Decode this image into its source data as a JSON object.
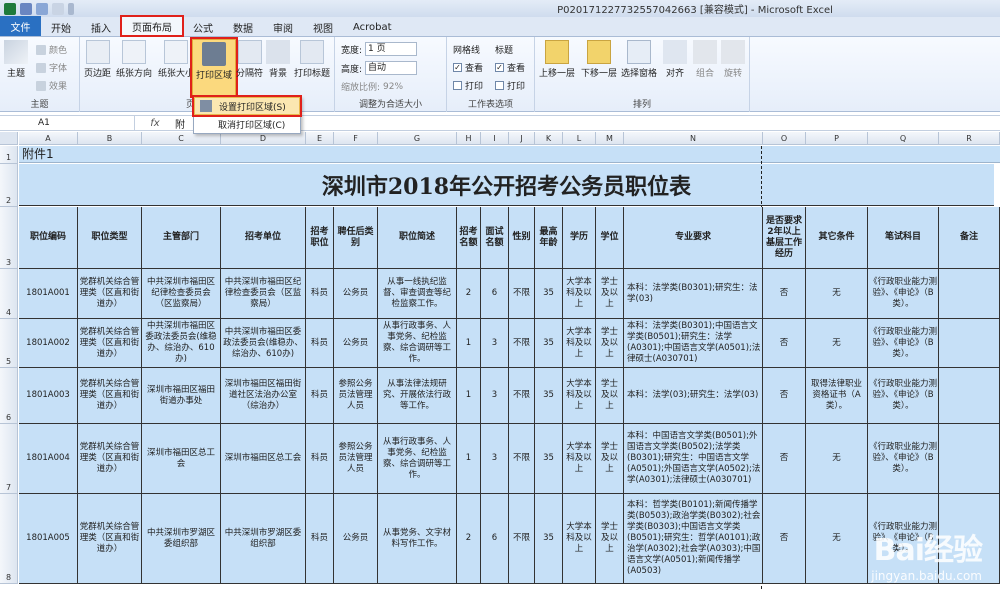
{
  "window": {
    "title": "P020171227732557042663 [兼容模式] - Microsoft Excel"
  },
  "tabs": {
    "file": "文件",
    "items": [
      "开始",
      "插入",
      "页面布局",
      "公式",
      "数据",
      "审阅",
      "视图",
      "Acrobat"
    ],
    "active": "页面布局"
  },
  "ribbon": {
    "theme": {
      "main": "主题",
      "colors": "颜色",
      "fonts": "字体",
      "effects": "效果",
      "group": "主题"
    },
    "page_setup": {
      "margins": "页边距",
      "orientation": "纸张方向",
      "size": "纸张大小",
      "print_area": "打印区域",
      "breaks": "分隔符",
      "background": "背景",
      "print_titles": "打印标题",
      "group": "页"
    },
    "scale": {
      "width_label": "宽度:",
      "width_value": "1 页",
      "height_label": "高度:",
      "height_value": "自动",
      "scale_label": "缩放比例:",
      "scale_value": "92%",
      "group": "调整为合适大小"
    },
    "sheet_options": {
      "gridlines": "网格线",
      "headings": "标题",
      "view": "查看",
      "print": "打印",
      "group": "工作表选项"
    },
    "arrange": {
      "bring_forward": "上移一层",
      "send_backward": "下移一层",
      "selection_pane": "选择窗格",
      "align": "对齐",
      "group_btn": "组合",
      "rotate": "旋转",
      "group": "排列"
    }
  },
  "print_area_menu": {
    "set": "设置打印区域(S)",
    "clear": "取消打印区域(C)"
  },
  "formula_bar": {
    "name_box": "A1",
    "fx": "fx",
    "value": "附"
  },
  "columns": [
    "A",
    "B",
    "C",
    "D",
    "E",
    "F",
    "G",
    "H",
    "I",
    "J",
    "K",
    "L",
    "M",
    "N",
    "O",
    "P",
    "Q",
    "R"
  ],
  "rows": [
    "1",
    "2",
    "3",
    "4",
    "5",
    "6",
    "7",
    "8"
  ],
  "sheet": {
    "a1": "附件1",
    "title": "深圳市2018年公开招考公务员职位表",
    "headers": [
      "职位编码",
      "职位类型",
      "主管部门",
      "招考单位",
      "招考职位",
      "聘任后类别",
      "职位简述",
      "招考名额",
      "面试名额",
      "性别",
      "最高年龄",
      "学历",
      "学位",
      "专业要求",
      "是否要求2年以上基层工作经历",
      "其它条件",
      "笔试科目",
      "备注"
    ],
    "records": [
      [
        "1801A001",
        "党群机关综合管理类（区直和街道办）",
        "中共深圳市福田区纪律检查委员会（区监察局）",
        "中共深圳市福田区纪律检查委员会（区监察局）",
        "科员",
        "公务员",
        "从事一线执纪监督、审查调查等纪检监察工作。",
        "2",
        "6",
        "不限",
        "35",
        "大学本科及以上",
        "学士及以上",
        "本科：法学类(B0301);研究生：法学(03)",
        "否",
        "无",
        "《行政职业能力测验》、《申论》（B类）。",
        ""
      ],
      [
        "1801A002",
        "党群机关综合管理类（区直和街道办）",
        "中共深圳市福田区委政法委员会(维稳办、综治办、610办)",
        "中共深圳市福田区委政法委员会(维稳办、综治办、610办)",
        "科员",
        "公务员",
        "从事行政事务、人事党务、纪检监察、综合调研等工作。",
        "1",
        "3",
        "不限",
        "35",
        "大学本科及以上",
        "学士及以上",
        "本科：法学类(B0301);中国语言文学类(B0501);研究生：法学(A0301);中国语言文学(A0501);法律硕士(A030701)",
        "否",
        "无",
        "《行政职业能力测验》、《申论》（B类）。",
        ""
      ],
      [
        "1801A003",
        "党群机关综合管理类（区直和街道办）",
        "深圳市福田区福田街道办事处",
        "深圳市福田区福田街道社区法治办公室（综治办）",
        "科员",
        "参照公务员法管理人员",
        "从事法律法规研究、开展依法行政等工作。",
        "1",
        "3",
        "不限",
        "35",
        "大学本科及以上",
        "学士及以上",
        "本科：法学(03);研究生：法学(03)",
        "否",
        "取得法律职业资格证书（A类）。",
        "《行政职业能力测验》、《申论》（B类）。",
        ""
      ],
      [
        "1801A004",
        "党群机关综合管理类（区直和街道办）",
        "深圳市福田区总工会",
        "深圳市福田区总工会",
        "科员",
        "参照公务员法管理人员",
        "从事行政事务、人事党务、纪检监察、综合调研等工作。",
        "1",
        "3",
        "不限",
        "35",
        "大学本科及以上",
        "学士及以上",
        "本科：中国语言文学类(B0501);外国语言文学类(B0502);法学类(B0301);研究生：中国语言文学(A0501);外国语言文学(A0502);法学(A0301);法律硕士(A030701)",
        "否",
        "无",
        "《行政职业能力测验》、《申论》（B类）。",
        ""
      ],
      [
        "1801A005",
        "党群机关综合管理类（区直和街道办）",
        "中共深圳市罗湖区委组织部",
        "中共深圳市罗湖区委组织部",
        "科员",
        "公务员",
        "从事党务、文字材料写作工作。",
        "2",
        "6",
        "不限",
        "35",
        "大学本科及以上",
        "学士及以上",
        "本科：哲学类(B0101);新闻传播学类(B0503);政治学类(B0302);社会学类(B0303);中国语言文学类(B0501);研究生：哲学(A0101);政治学(A0302);社会学(A0303);中国语言文学(A0501);新闻传播学(A0503)",
        "否",
        "无",
        "《行政职业能力测验》、《申论》（B类）。",
        ""
      ]
    ]
  },
  "watermark": {
    "brand": "Bai经验",
    "url": "jingyan.baidu.com"
  },
  "colors": {
    "cell_bg": "#c6e0f7",
    "file_tab": "#2a70c2",
    "highlight": "#e0201a"
  }
}
